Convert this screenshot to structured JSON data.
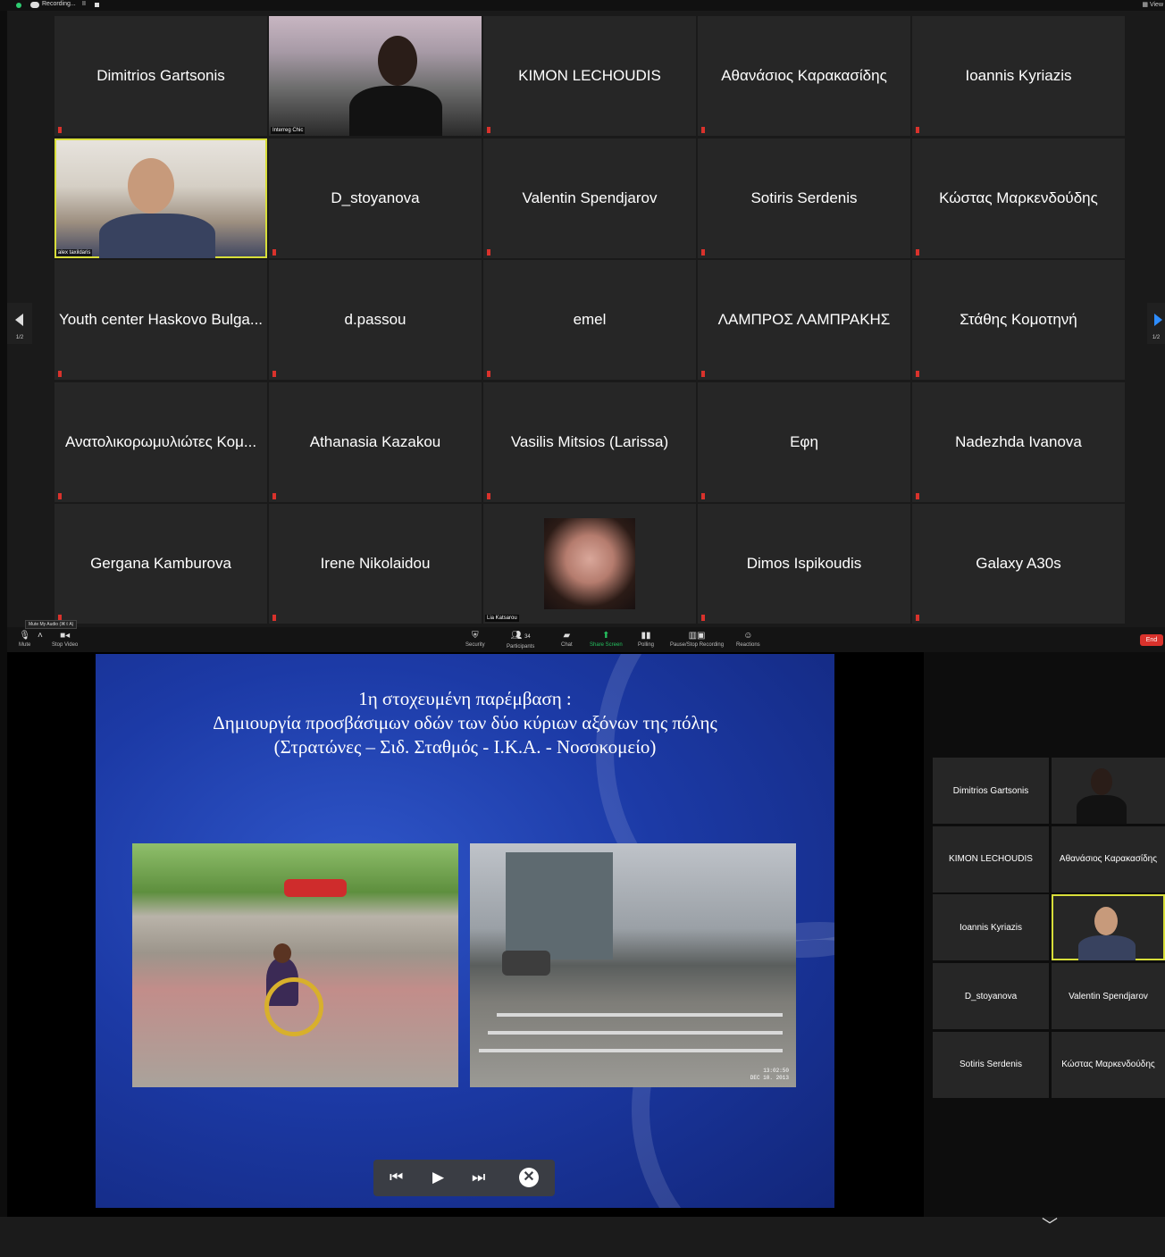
{
  "top_bar": {
    "recording_text": "Recording...",
    "pause_icon": "II",
    "view_label": "View"
  },
  "gallery": {
    "page_indicator": "1/2",
    "tiles": [
      {
        "name": "Dimitrios Gartsonis",
        "type": "name"
      },
      {
        "name": "Interreg Chic",
        "type": "video-woman"
      },
      {
        "name": "KIMON LECHOUDIS",
        "type": "name"
      },
      {
        "name": "Αθανάσιος Καρακασίδης",
        "type": "name"
      },
      {
        "name": "Ioannis Kyriazis",
        "type": "name"
      },
      {
        "name": "alex taxildaris",
        "type": "video-man",
        "active": true
      },
      {
        "name": "D_stoyanova",
        "type": "name"
      },
      {
        "name": "Valentin Spendjarov",
        "type": "name"
      },
      {
        "name": "Sotiris Serdenis",
        "type": "name"
      },
      {
        "name": "Κώστας Μαρκενδούδης",
        "type": "name"
      },
      {
        "name": "Youth center Haskovo Bulga...",
        "type": "name"
      },
      {
        "name": "d.passou",
        "type": "name"
      },
      {
        "name": "emel",
        "type": "name"
      },
      {
        "name": "ΛΑΜΠΡΟΣ ΛΑΜΠΡΑΚΗΣ",
        "type": "name"
      },
      {
        "name": "Στάθης Κομοτηνή",
        "type": "name"
      },
      {
        "name": "Ανατολικορωμυλιώτες Κομ...",
        "type": "name"
      },
      {
        "name": "Athanasia Kazakou",
        "type": "name"
      },
      {
        "name": "Vasilis Mitsios (Larissa)",
        "type": "name"
      },
      {
        "name": "Εφη",
        "type": "name"
      },
      {
        "name": "Nadezhda Ivanova",
        "type": "name"
      },
      {
        "name": "Gergana Kamburova",
        "type": "name"
      },
      {
        "name": "Irene Nikolaidou",
        "type": "name"
      },
      {
        "name": "Lia Katsarou",
        "type": "photo"
      },
      {
        "name": "Dimos Ispikoudis",
        "type": "name"
      },
      {
        "name": "Galaxy A30s",
        "type": "name"
      }
    ]
  },
  "toolbar": {
    "mute_tooltip": "Mute My Audio (⌘⇧A)",
    "mute": "Mute",
    "stop_video": "Stop Video",
    "security": "Security",
    "participants": "Participants",
    "participants_count": "34",
    "chat": "Chat",
    "share_screen": "Share Screen",
    "polling": "Polling",
    "pause_stop_recording": "Pause/Stop Recording",
    "reactions": "Reactions",
    "end": "End"
  },
  "slide": {
    "title_line1": "1η στοχευμένη παρέμβαση :",
    "title_line2": "Δημιουργία προσβάσιμων οδών των δύο κύριων αξόνων της πόλης",
    "title_line3": "(Στρατώνες – Σιδ. Σταθμός -  Ι.Κ.Α. - Νοσοκομείο)",
    "photo_time": "13:02:50",
    "photo_date": "DEC 10. 2013"
  },
  "side_panel": {
    "tiles": [
      {
        "name": "Dimitrios Gartsonis",
        "type": "name"
      },
      {
        "name": "",
        "type": "video-woman"
      },
      {
        "name": "KIMON LECHOUDIS",
        "type": "name"
      },
      {
        "name": "Αθανάσιος Καρακασίδης",
        "type": "name"
      },
      {
        "name": "Ioannis Kyriazis",
        "type": "name"
      },
      {
        "name": "",
        "type": "video-man",
        "active": true
      },
      {
        "name": "D_stoyanova",
        "type": "name"
      },
      {
        "name": "Valentin Spendjarov",
        "type": "name"
      },
      {
        "name": "Sotiris Serdenis",
        "type": "name"
      },
      {
        "name": "Κώστας Μαρκενδούδης",
        "type": "name"
      }
    ]
  },
  "colors": {
    "active_speaker": "#d8de3a",
    "muted": "#d9322c",
    "share_green": "#25c05f",
    "end_red": "#d9322c"
  }
}
